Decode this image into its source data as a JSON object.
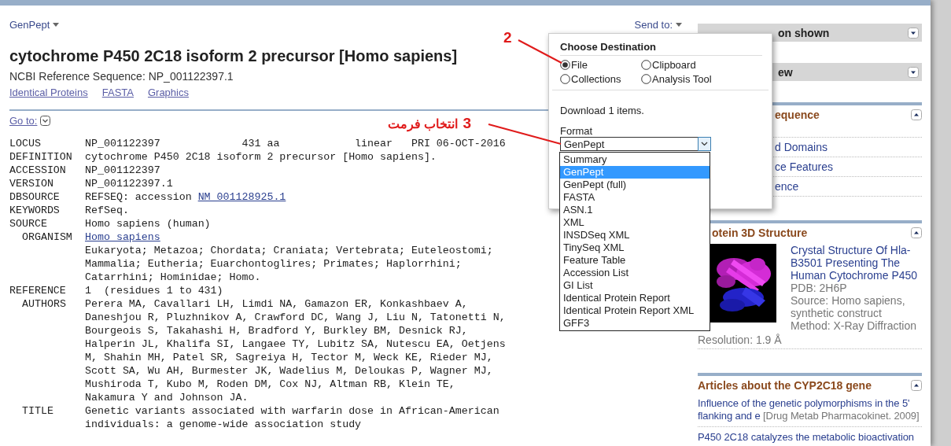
{
  "header": {
    "database": "GenPept",
    "send_to": "Send to:"
  },
  "title": "cytochrome P450 2C18 isoform 2 precursor [Homo sapiens]",
  "subtitle": "NCBI Reference Sequence: NP_001122397.1",
  "links": [
    "Identical Proteins",
    "FASTA",
    "Graphics"
  ],
  "goto": "Go to:",
  "record": [
    {
      "label": "LOCUS",
      "lines": [
        {
          "text": "NP_001122397             431 aa            linear   PRI 06-OCT-2016"
        }
      ]
    },
    {
      "label": "DEFINITION",
      "lines": [
        {
          "text": "cytochrome P450 2C18 isoform 2 precursor [Homo sapiens]."
        }
      ]
    },
    {
      "label": "ACCESSION",
      "lines": [
        {
          "text": "NP_001122397"
        }
      ]
    },
    {
      "label": "VERSION",
      "lines": [
        {
          "text": "NP_001122397.1"
        }
      ]
    },
    {
      "label": "DBSOURCE",
      "lines": [
        {
          "text": "REFSEQ: accession",
          "link": "NM_001128925.1"
        }
      ]
    },
    {
      "label": "KEYWORDS",
      "lines": [
        {
          "text": "RefSeq."
        }
      ]
    },
    {
      "label": "SOURCE",
      "lines": [
        {
          "text": "Homo sapiens (human)"
        }
      ],
      "children": [
        {
          "label": "ORGANISM",
          "lines": [
            {
              "link": "Homo sapiens"
            },
            {
              "text": "Eukaryota; Metazoa; Chordata; Craniata; Vertebrata; Euteleostomi;"
            },
            {
              "text": "Mammalia; Eutheria; Euarchontoglires; Primates; Haplorrhini;"
            },
            {
              "text": "Catarrhini; Hominidae; Homo."
            }
          ]
        }
      ]
    },
    {
      "label": "REFERENCE",
      "lines": [
        {
          "text": "1  (residues 1 to 431)"
        }
      ],
      "children": [
        {
          "label": "AUTHORS",
          "lines": [
            {
              "text": "Perera MA, Cavallari LH, Limdi NA, Gamazon ER, Konkashbaev A,"
            },
            {
              "text": "Daneshjou R, Pluzhnikov A, Crawford DC, Wang J, Liu N, Tatonetti N,"
            },
            {
              "text": "Bourgeois S, Takahashi H, Bradford Y, Burkley BM, Desnick RJ,"
            },
            {
              "text": "Halperin JL, Khalifa SI, Langaee TY, Lubitz SA, Nutescu EA, Oetjens"
            },
            {
              "text": "M, Shahin MH, Patel SR, Sagreiya H, Tector M, Weck KE, Rieder MJ,"
            },
            {
              "text": "Scott SA, Wu AH, Burmester JK, Wadelius M, Deloukas P, Wagner MJ,"
            },
            {
              "text": "Mushiroda T, Kubo M, Roden DM, Cox NJ, Altman RB, Klein TE,"
            },
            {
              "text": "Nakamura Y and Johnson JA."
            }
          ]
        },
        {
          "label": "TITLE",
          "lines": [
            {
              "text": "Genetic variants associated with warfarin dose in African-American"
            },
            {
              "text": "individuals: a genome-wide association study"
            }
          ]
        }
      ]
    }
  ],
  "popup": {
    "title": "Choose Destination",
    "destinations": [
      {
        "label": "File",
        "selected": true
      },
      {
        "label": "Clipboard",
        "selected": false
      },
      {
        "label": "Collections",
        "selected": false
      },
      {
        "label": "Analysis Tool",
        "selected": false
      }
    ],
    "message": "Download 1 items.",
    "format_label": "Format",
    "format_value": "GenPept",
    "format_options": [
      {
        "label": "Summary",
        "selected": false
      },
      {
        "label": "GenPept",
        "selected": true
      },
      {
        "label": "GenPept (full)",
        "selected": false
      },
      {
        "label": "FASTA",
        "selected": false
      },
      {
        "label": "ASN.1",
        "selected": false
      },
      {
        "label": "XML",
        "selected": false
      },
      {
        "label": "INSDSeq XML",
        "selected": false
      },
      {
        "label": "TinySeq XML",
        "selected": false
      },
      {
        "label": "Feature Table",
        "selected": false
      },
      {
        "label": "Accession List",
        "selected": false
      },
      {
        "label": "GI List",
        "selected": false
      },
      {
        "label": "Identical Protein Report",
        "selected": false
      },
      {
        "label": "Identical Protein Report XML",
        "selected": false
      },
      {
        "label": "GFF3",
        "selected": false
      }
    ]
  },
  "annotations": [
    {
      "label": "2"
    },
    {
      "label": "3",
      "caption": "انتخاب فرمت"
    }
  ],
  "sidebar": [
    {
      "title": "on shown",
      "kind": "behind-popup",
      "expanded": false
    },
    {
      "title": "ew",
      "kind": "behind-popup",
      "expanded": false
    },
    {
      "title": "equence",
      "kind": "behind-popup",
      "expanded": true,
      "links": [
        {
          "text": "d Domains",
          "kind": "behind-popup"
        },
        {
          "text": "ce Features",
          "kind": "behind-popup"
        },
        {
          "text": "ence",
          "kind": "behind-popup"
        }
      ]
    },
    {
      "title": "otein 3D Structure",
      "kind": "behind-list",
      "expanded": true,
      "structure": {
        "name": "Crystal Structure Of Hla-B3501 Presenting The Human Cytochrome P450",
        "details": [
          "PDB: 2H6P",
          "Source: Homo sapiens, synthetic construct",
          "Method: X-Ray Diffraction"
        ],
        "resolution": "Resolution: 1.9 Å"
      }
    },
    {
      "title": "Articles about the CYP2C18 gene",
      "kind": "full",
      "expanded": true,
      "articles": [
        {
          "title": "Influence of the genetic polymorphisms in the 5' flanking and e",
          "source": "[Drug Metab Pharmacokinet. 2009]"
        },
        {
          "title": "P450 2C18 catalyzes the metabolic bioactivation"
        }
      ]
    }
  ]
}
